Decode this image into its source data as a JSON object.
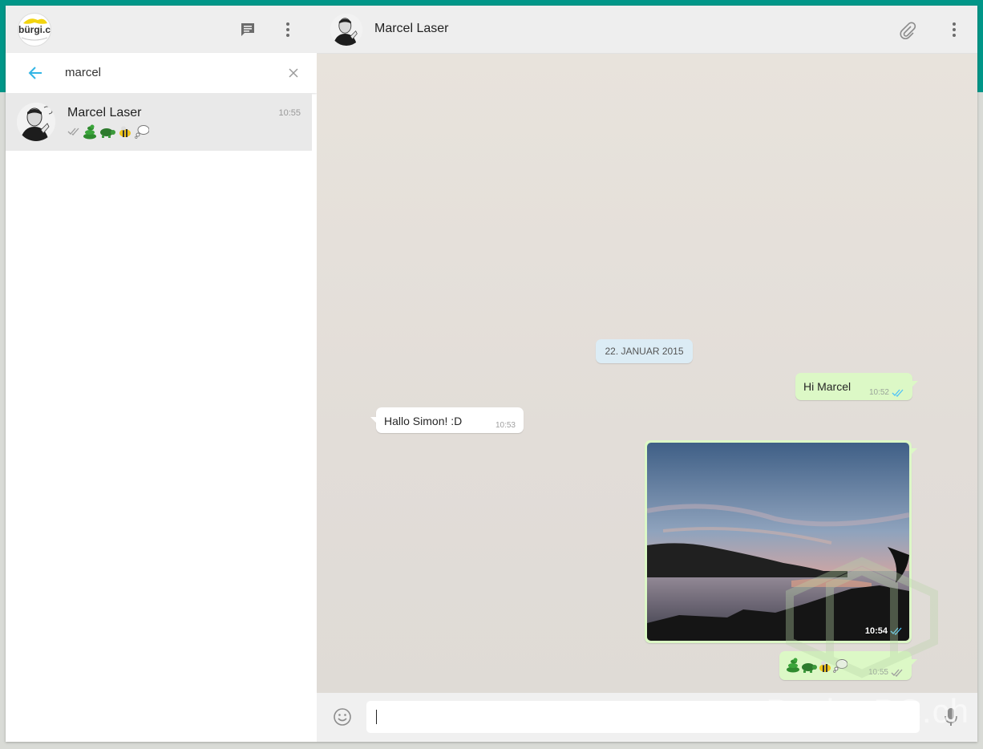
{
  "left": {
    "logo_text": "bürgi.ch",
    "search": {
      "value": "marcel"
    },
    "results": [
      {
        "name": "Marcel Laser",
        "time": "10:55"
      }
    ]
  },
  "conversation": {
    "contact_name": "Marcel Laser",
    "date_separator": "22. JANUAR 2015",
    "messages": [
      {
        "direction": "out",
        "text": "Hi Marcel",
        "time": "10:52"
      },
      {
        "direction": "in",
        "text": "Hallo Simon! :D",
        "time": "10:53"
      },
      {
        "direction": "out",
        "type": "image",
        "time": "10:54"
      },
      {
        "direction": "out",
        "type": "emoji",
        "emojis": [
          "snake",
          "turtle",
          "bee",
          "thought-balloon"
        ],
        "time": "10:55"
      }
    ]
  },
  "composer": {
    "value": ""
  },
  "watermark": "PocketPC.ch",
  "colors": {
    "accent_band": "#009688",
    "outgoing_bubble": "#dcf8c6",
    "incoming_bubble": "#ffffff",
    "date_chip": "#dcecf5",
    "read_ticks": "#4fc3f7",
    "back_arrow": "#33b5e5"
  },
  "icons": [
    "new-chat-icon",
    "menu-icon",
    "back-arrow-icon",
    "clear-icon",
    "attach-icon",
    "emoji-icon",
    "microphone-icon",
    "double-check-icon"
  ]
}
